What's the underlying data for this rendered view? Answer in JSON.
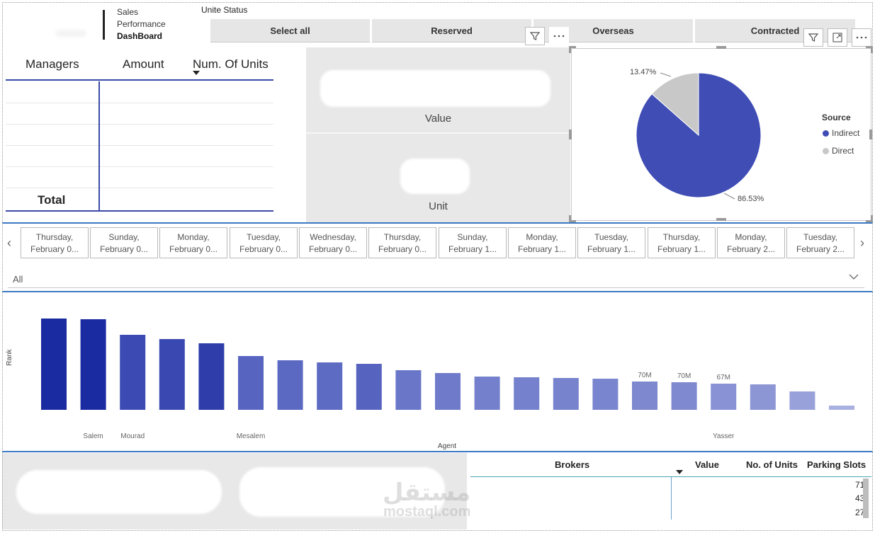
{
  "header": {
    "logo_line1": "Sales",
    "logo_line2": "Performance",
    "logo_line3": "DashBoard",
    "unite_status_title": "Unite Status",
    "status_buttons": [
      "Select all",
      "Reserved",
      "Overseas",
      "Contracted"
    ]
  },
  "matrix": {
    "columns": [
      "Managers",
      "Amount",
      "Num. Of Units"
    ],
    "total_label": "Total"
  },
  "cards": {
    "value_label": "Value",
    "unit_label": "Unit"
  },
  "pie": {
    "legend_title": "Source",
    "slices": [
      {
        "name": "Indirect",
        "percent": 86.53,
        "label": "86.53%",
        "color": "#3f4db5"
      },
      {
        "name": "Direct",
        "percent": 13.47,
        "label": "13.47%",
        "color": "#c8c8c8"
      }
    ]
  },
  "date_slicer": {
    "tiles": [
      [
        "Thursday,",
        "February 0..."
      ],
      [
        "Sunday,",
        "February 0..."
      ],
      [
        "Monday,",
        "February 0..."
      ],
      [
        "Tuesday,",
        "February 0..."
      ],
      [
        "Wednesday,",
        "February 0..."
      ],
      [
        "Thursday,",
        "February 0..."
      ],
      [
        "Sunday,",
        "February 1..."
      ],
      [
        "Monday,",
        "February 1..."
      ],
      [
        "Tuesday,",
        "February 1..."
      ],
      [
        "Thursday,",
        "February 1..."
      ],
      [
        "Monday,",
        "February 2..."
      ],
      [
        "Tuesday,",
        "February 2..."
      ]
    ],
    "dropdown_value": "All"
  },
  "chart_data": {
    "type": "bar",
    "title": "",
    "xlabel": "Agent",
    "ylabel": "Rank",
    "categories": [
      "",
      "Salem",
      "Mourad",
      "",
      "",
      "Mesalem",
      "",
      "",
      "",
      "",
      "",
      "",
      "",
      "",
      "",
      "",
      "",
      "Yasser",
      "",
      "",
      ""
    ],
    "values": [
      129,
      128,
      106,
      100,
      94,
      76,
      70,
      67,
      65,
      56,
      52,
      47,
      46,
      45,
      44,
      40,
      39,
      37,
      36,
      26,
      6
    ],
    "data_labels": [
      "",
      "",
      "",
      "",
      "",
      "",
      "",
      "",
      "",
      "",
      "",
      "",
      "",
      "",
      "",
      "70M",
      "70M",
      "67M",
      "",
      "",
      ""
    ],
    "colors": [
      "#1a2aa0",
      "#1a2aa0",
      "#3c4bb3",
      "#3a49b2",
      "#2e3daa",
      "#5865c0",
      "#5c69c2",
      "#5e6bc3",
      "#5764bf",
      "#6a76c8",
      "#6f7bca",
      "#7480cc",
      "#7581cc",
      "#7783cd",
      "#7985ce",
      "#7d88cf",
      "#7e89d0",
      "#8892d4",
      "#8c96d5",
      "#98a1da",
      "#a9b1e1"
    ],
    "ylim": [
      0,
      140
    ],
    "grid": false
  },
  "brokers": {
    "columns": [
      "Brokers",
      "Value",
      "No. of Units",
      "Parking Slots"
    ],
    "parking_values": [
      "71",
      "43",
      "27"
    ]
  },
  "watermark": {
    "arabic": "مستقل",
    "domain": "mostaql.com"
  }
}
